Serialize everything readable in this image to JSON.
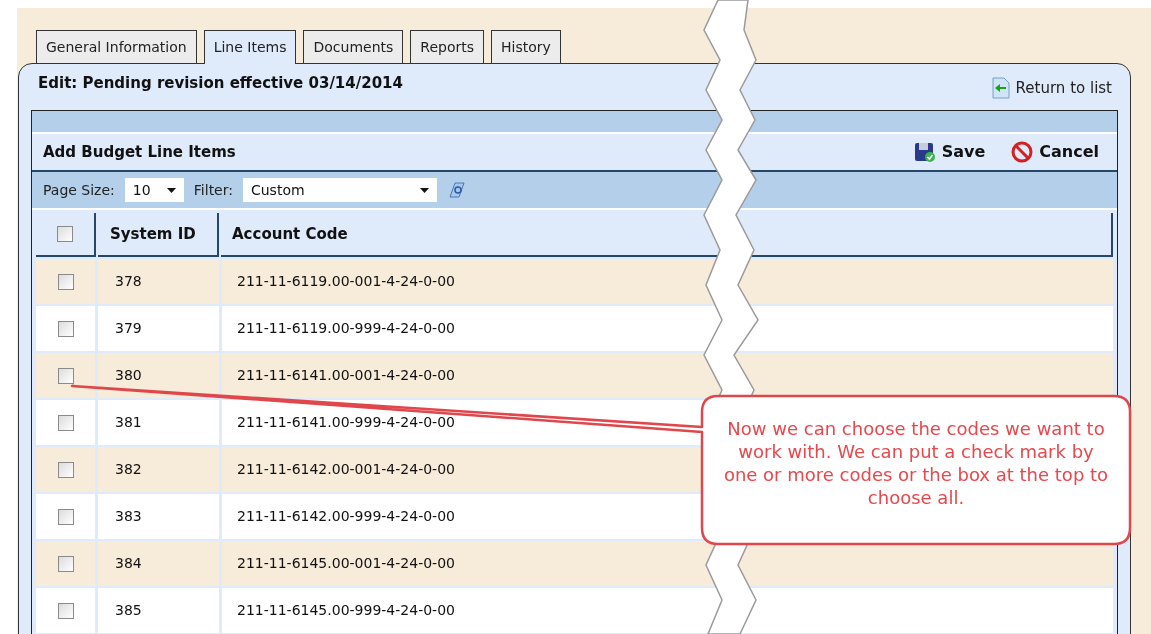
{
  "tabs": [
    {
      "label": "General Information",
      "selected": false
    },
    {
      "label": "Line Items",
      "selected": true
    },
    {
      "label": "Documents",
      "selected": false
    },
    {
      "label": "Reports",
      "selected": false
    },
    {
      "label": "History",
      "selected": false
    }
  ],
  "panel": {
    "title": "Edit: Pending revision effective 03/14/2014",
    "return_link": "Return to list"
  },
  "grid": {
    "title": "Add Budget Line Items",
    "actions": [
      {
        "kind": "save",
        "label": "Save"
      },
      {
        "kind": "cancel",
        "label": "Cancel"
      }
    ],
    "page_size": {
      "label": "Page Size:",
      "value": "10"
    },
    "filter": {
      "label": "Filter:",
      "value": "Custom"
    },
    "header": {
      "checked": false,
      "columns": [
        "System ID",
        "Account Code"
      ]
    },
    "rows": [
      {
        "checked": false,
        "system_id": "378",
        "account_code": "211-11-6119.00-001-4-24-0-00"
      },
      {
        "checked": false,
        "system_id": "379",
        "account_code": "211-11-6119.00-999-4-24-0-00"
      },
      {
        "checked": false,
        "system_id": "380",
        "account_code": "211-11-6141.00-001-4-24-0-00"
      },
      {
        "checked": false,
        "system_id": "381",
        "account_code": "211-11-6141.00-999-4-24-0-00"
      },
      {
        "checked": false,
        "system_id": "382",
        "account_code": "211-11-6142.00-001-4-24-0-00"
      },
      {
        "checked": false,
        "system_id": "383",
        "account_code": "211-11-6142.00-999-4-24-0-00"
      },
      {
        "checked": false,
        "system_id": "384",
        "account_code": "211-11-6145.00-001-4-24-0-00"
      },
      {
        "checked": false,
        "system_id": "385",
        "account_code": "211-11-6145.00-999-4-24-0-00"
      }
    ]
  },
  "callout": {
    "text": "Now we can choose the codes we want to work with. We can put a check mark by one or more codes or the box at the top to choose all."
  }
}
